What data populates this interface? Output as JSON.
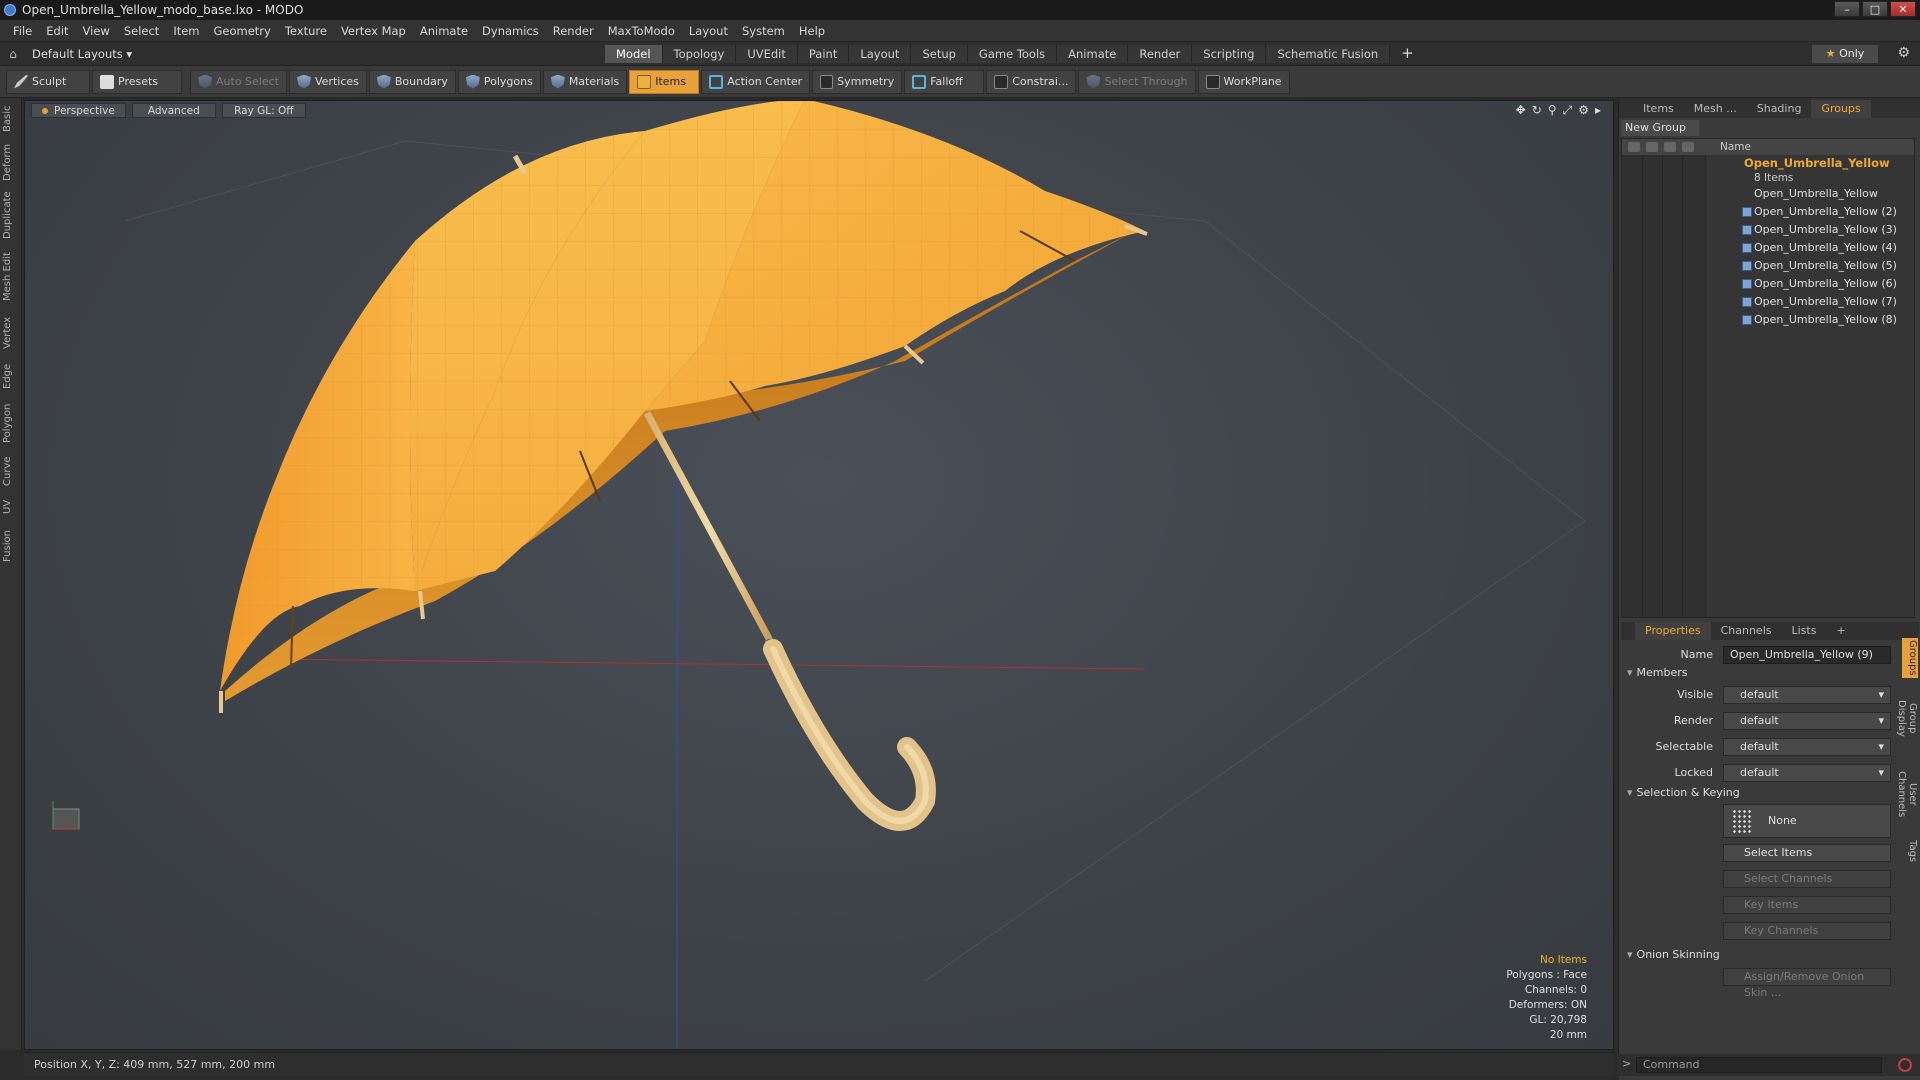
{
  "window": {
    "title": "Open_Umbrella_Yellow_modo_base.lxo - MODO",
    "min": "–",
    "max": "□",
    "close": "✕"
  },
  "menu": [
    "File",
    "Edit",
    "View",
    "Select",
    "Item",
    "Geometry",
    "Texture",
    "Vertex Map",
    "Animate",
    "Dynamics",
    "Render",
    "MaxToModo",
    "Layout",
    "System",
    "Help"
  ],
  "layouts": {
    "label": "Default Layouts ▾"
  },
  "tabs": [
    "Model",
    "Topology",
    "UVEdit",
    "Paint",
    "Layout",
    "Setup",
    "Game Tools",
    "Animate",
    "Render",
    "Scripting",
    "Schematic Fusion"
  ],
  "tab_plus": "+",
  "only": "Only",
  "toolbar": {
    "sculpt": "Sculpt",
    "presets": "Presets",
    "auto_select": "Auto Select",
    "vertices": "Vertices",
    "boundary": "Boundary",
    "polygons": "Polygons",
    "materials": "Materials",
    "items": "Items",
    "action_center": "Action Center",
    "symmetry": "Symmetry",
    "falloff": "Falloff",
    "constraints": "Constrai...",
    "select_through": "Select Through",
    "workplane": "WorkPlane"
  },
  "left_tabs": [
    "Basic",
    "Deform",
    "Duplicate",
    "Mesh Edit",
    "Vertex",
    "Edge",
    "Polygon",
    "Curve",
    "UV",
    "Fusion"
  ],
  "viewport": {
    "perspective": "Perspective",
    "advanced": "Advanced",
    "raygl": "Ray GL: Off",
    "info": {
      "no_items": "No Items",
      "polygons": "Polygons : Face",
      "channels": "Channels: 0",
      "deformers": "Deformers: ON",
      "gl": "GL: 20,798",
      "scale": "20 mm"
    }
  },
  "status": {
    "position": "Position X, Y, Z:   409 mm, 527 mm, 200 mm"
  },
  "right_panel": {
    "tabs": [
      "Items",
      "Mesh ...",
      "Shading",
      "Groups"
    ],
    "new_group": "New Group",
    "name_header": "Name",
    "group_name": "Open_Umbrella_Yellow",
    "group_count": "8 Items",
    "items": [
      "Open_Umbrella_Yellow",
      "Open_Umbrella_Yellow (2)",
      "Open_Umbrella_Yellow (3)",
      "Open_Umbrella_Yellow (4)",
      "Open_Umbrella_Yellow (5)",
      "Open_Umbrella_Yellow (6)",
      "Open_Umbrella_Yellow (7)",
      "Open_Umbrella_Yellow (8)"
    ]
  },
  "properties": {
    "tabs": [
      "Properties",
      "Channels",
      "Lists",
      "+"
    ],
    "name_label": "Name",
    "name_value": "Open_Umbrella_Yellow (9)",
    "members": "Members",
    "visible_label": "Visible",
    "render_label": "Render",
    "selectable_label": "Selectable",
    "locked_label": "Locked",
    "default": "default",
    "selection_keying": "Selection & Keying",
    "none": "None",
    "select_items": "Select Items",
    "select_channels": "Select Channels",
    "key_items": "Key Items",
    "key_channels": "Key Channels",
    "onion": "Onion Skinning",
    "assign_onion": "Assign/Remove Onion Skin ...",
    "side_tabs": [
      "Groups",
      "Group Display",
      "User Channels",
      "Tags"
    ]
  },
  "command": {
    "placeholder": "Command",
    "prompt": ">"
  },
  "colors": {
    "accent": "#e9a23a",
    "umbrella": "#f5b040",
    "handle": "#e8c890"
  }
}
